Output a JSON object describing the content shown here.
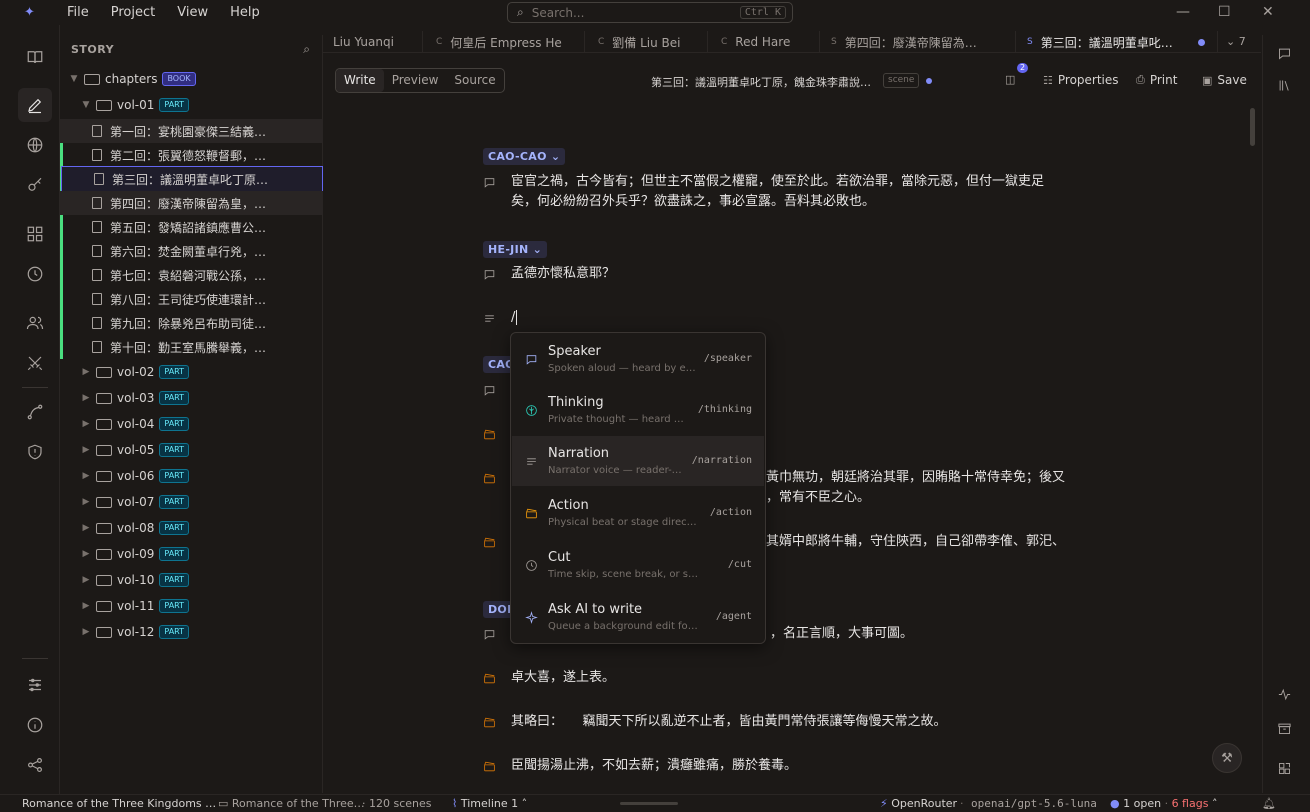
{
  "menu": [
    "File",
    "Project",
    "View",
    "Help"
  ],
  "search": {
    "placeholder": "Search...",
    "shortcut": "Ctrl K"
  },
  "sidebar": {
    "title": "STORY",
    "root": {
      "label": "chapters",
      "badge": "BOOK"
    },
    "open_volume": {
      "label": "vol-01",
      "badge": "PART"
    },
    "chapters": [
      "第一回：宴桃園豪傑三結義…",
      "第二回：張翼德怒鞭督郵，…",
      "第三回：議溫明董卓叱丁原…",
      "第四回：廢漢帝陳留為皇，…",
      "第五回：發矯詔諸鎮應曹公…",
      "第六回：焚金闕董卓行兇，…",
      "第七回：袁紹磐河戰公孫，…",
      "第八回：王司徒巧使連環計…",
      "第九回：除暴兇呂布助司徒…",
      "第十回：勤王室馬騰舉義，…"
    ],
    "volumes": [
      "vol-02",
      "vol-03",
      "vol-04",
      "vol-05",
      "vol-06",
      "vol-07",
      "vol-08",
      "vol-09",
      "vol-10",
      "vol-11",
      "vol-12"
    ],
    "part_badge": "PART"
  },
  "tabs": [
    {
      "prefix": "",
      "label": "Liu Yuanqi"
    },
    {
      "prefix": "C",
      "label": "何皇后 Empress He"
    },
    {
      "prefix": "C",
      "label": "劉備 Liu Bei"
    },
    {
      "prefix": "C",
      "label": "Red Hare"
    },
    {
      "prefix": "S",
      "label": "第四回：廢漢帝陳留為…"
    },
    {
      "prefix": "S",
      "label": "第三回：議溫明董卓叱…"
    }
  ],
  "tab_overflow": "7",
  "toolbar": {
    "modes": [
      "Write",
      "Preview",
      "Source"
    ],
    "doc_title": "第三回：議溫明董卓叱丁原，餽金珠李肅說…",
    "doc_kind": "scene",
    "panel_count": "2",
    "properties": "Properties",
    "print": "Print",
    "save": "Save"
  },
  "editor": {
    "speaker1": "CAO-CAO",
    "line1a": "宦官之禍，古今皆有；但世主不當假之權寵，使至於此。若欲治罪，當除元惡，但付一獄吏足",
    "line1b": "矣，何必紛紛召外兵乎？欲盡誅之，事必宣露。吾料其必敗也。",
    "speaker2": "HE-JIN",
    "line2": "孟德亦懷私意耶？",
    "slash": "/",
    "speaker3_partial": "CAO",
    "frag1a": "黃巾無功，朝廷將治其罪，因賄賂十常侍幸免；後又",
    "frag1b": "，常有不臣之心。",
    "frag2": "其婿中郎將牛輔，守住陝西，自己卻帶李傕、郭汜、",
    "speaker4_partial": "DON",
    "frag3": "，名正言順，大事可圖。",
    "line5": "卓大喜，遂上表。",
    "line6": "其略曰：　　竊聞天下所以亂逆不止者，皆由黃門常侍張讓等侮慢天常之故。",
    "line7": "臣聞揚湯止沸，不如去薪；潰癰雖痛，勝於養毒。"
  },
  "popup": [
    {
      "title": "Speaker",
      "desc": "Spoken aloud — heard by e…",
      "cmd": "/speaker",
      "icon": "speech-bubble-icon"
    },
    {
      "title": "Thinking",
      "desc": "Private thought — heard …",
      "cmd": "/thinking",
      "icon": "brain-icon"
    },
    {
      "title": "Narration",
      "desc": "Narrator voice — reader-…",
      "cmd": "/narration",
      "icon": "lines-icon"
    },
    {
      "title": "Action",
      "desc": "Physical beat or stage directi…",
      "cmd": "/action",
      "icon": "clapper-icon"
    },
    {
      "title": "Cut",
      "desc": "Time skip, scene break, or separ…",
      "cmd": "/cut",
      "icon": "clock-icon"
    },
    {
      "title": "Ask AI to write",
      "desc": "Queue a background edit for t…",
      "cmd": "/agent",
      "icon": "sparkle-icon"
    }
  ],
  "status": {
    "project": "Romance of the Three Kingdoms …",
    "path": "Romance of the Three…",
    "scenes": "· 120 scenes",
    "timeline": "Timeline 1",
    "provider": "OpenRouter",
    "model": "openai/gpt-5.6-luna",
    "open": "1 open",
    "flags": "6 flags"
  },
  "colors": {
    "accent": "#818cf8",
    "chapter_marker": "#4ade80",
    "flags": "#f87171"
  }
}
